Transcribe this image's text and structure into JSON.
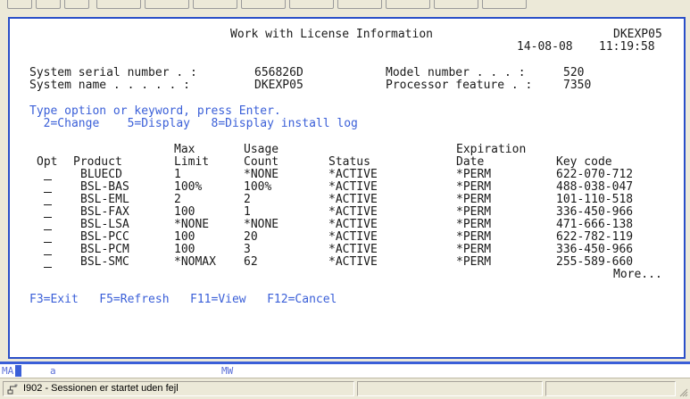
{
  "screen": {
    "title": "Work with License Information",
    "system_id": "DKEXP05",
    "date": "14-08-08",
    "time": "11:19:58",
    "serial_label": "System serial number . :",
    "serial_value": "656826D",
    "model_label": "Model number . . . :",
    "model_value": "520",
    "sysname_label": "System name . . . . . :",
    "sysname_value": "DKEXP05",
    "processor_label": "Processor feature . :",
    "processor_value": "7350",
    "instructions": "Type option or keyword, press Enter.",
    "options": "  2=Change    5=Display   8=Display install log",
    "headers_line1": {
      "max": "Max",
      "usage": "Usage",
      "expiration": "Expiration"
    },
    "headers_line2": {
      "opt": "Opt",
      "product": "Product",
      "limit": "Limit",
      "count": "Count",
      "status": "Status",
      "date": "Date",
      "key": "Key code"
    },
    "rows": [
      {
        "product": "BLUECD",
        "limit": "1",
        "count": "*NONE",
        "status": "*ACTIVE",
        "date": "*PERM",
        "key": "622-070-712"
      },
      {
        "product": "BSL-BAS",
        "limit": "100%",
        "count": "100%",
        "status": "*ACTIVE",
        "date": "*PERM",
        "key": "488-038-047"
      },
      {
        "product": "BSL-EML",
        "limit": "2",
        "count": "2",
        "status": "*ACTIVE",
        "date": "*PERM",
        "key": "101-110-518"
      },
      {
        "product": "BSL-FAX",
        "limit": "100",
        "count": "1",
        "status": "*ACTIVE",
        "date": "*PERM",
        "key": "336-450-966"
      },
      {
        "product": "BSL-LSA",
        "limit": "*NONE",
        "count": "*NONE",
        "status": "*ACTIVE",
        "date": "*PERM",
        "key": "471-666-138"
      },
      {
        "product": "BSL-PCC",
        "limit": "100",
        "count": "20",
        "status": "*ACTIVE",
        "date": "*PERM",
        "key": "622-782-119"
      },
      {
        "product": "BSL-PCM",
        "limit": "100",
        "count": "3",
        "status": "*ACTIVE",
        "date": "*PERM",
        "key": "336-450-966"
      },
      {
        "product": "BSL-SMC",
        "limit": "*NOMAX",
        "count": "62",
        "status": "*ACTIVE",
        "date": "*PERM",
        "key": "255-589-660"
      }
    ],
    "more": "More...",
    "fkeys": "F3=Exit   F5=Refresh   F11=View   F12=Cancel"
  },
  "oia": {
    "mode": "MA",
    "field": "a",
    "mw": "MW"
  },
  "statusbar": {
    "message": "I902 - Sessionen er startet uden fejl"
  },
  "colors": {
    "accent": "#3a5fd8",
    "frame": "#2a4fc8",
    "chrome": "#ece9d8"
  }
}
